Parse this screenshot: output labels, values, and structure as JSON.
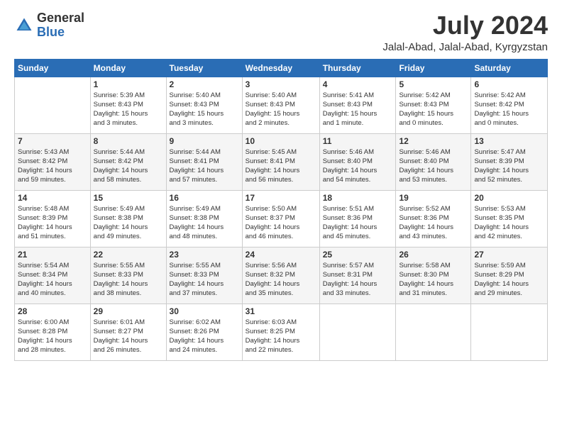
{
  "header": {
    "logo_general": "General",
    "logo_blue": "Blue",
    "month_title": "July 2024",
    "location": "Jalal-Abad, Jalal-Abad, Kyrgyzstan"
  },
  "weekdays": [
    "Sunday",
    "Monday",
    "Tuesday",
    "Wednesday",
    "Thursday",
    "Friday",
    "Saturday"
  ],
  "weeks": [
    [
      {
        "day": "",
        "info": ""
      },
      {
        "day": "1",
        "info": "Sunrise: 5:39 AM\nSunset: 8:43 PM\nDaylight: 15 hours\nand 3 minutes."
      },
      {
        "day": "2",
        "info": "Sunrise: 5:40 AM\nSunset: 8:43 PM\nDaylight: 15 hours\nand 3 minutes."
      },
      {
        "day": "3",
        "info": "Sunrise: 5:40 AM\nSunset: 8:43 PM\nDaylight: 15 hours\nand 2 minutes."
      },
      {
        "day": "4",
        "info": "Sunrise: 5:41 AM\nSunset: 8:43 PM\nDaylight: 15 hours\nand 1 minute."
      },
      {
        "day": "5",
        "info": "Sunrise: 5:42 AM\nSunset: 8:43 PM\nDaylight: 15 hours\nand 0 minutes."
      },
      {
        "day": "6",
        "info": "Sunrise: 5:42 AM\nSunset: 8:42 PM\nDaylight: 15 hours\nand 0 minutes."
      }
    ],
    [
      {
        "day": "7",
        "info": "Sunrise: 5:43 AM\nSunset: 8:42 PM\nDaylight: 14 hours\nand 59 minutes."
      },
      {
        "day": "8",
        "info": "Sunrise: 5:44 AM\nSunset: 8:42 PM\nDaylight: 14 hours\nand 58 minutes."
      },
      {
        "day": "9",
        "info": "Sunrise: 5:44 AM\nSunset: 8:41 PM\nDaylight: 14 hours\nand 57 minutes."
      },
      {
        "day": "10",
        "info": "Sunrise: 5:45 AM\nSunset: 8:41 PM\nDaylight: 14 hours\nand 56 minutes."
      },
      {
        "day": "11",
        "info": "Sunrise: 5:46 AM\nSunset: 8:40 PM\nDaylight: 14 hours\nand 54 minutes."
      },
      {
        "day": "12",
        "info": "Sunrise: 5:46 AM\nSunset: 8:40 PM\nDaylight: 14 hours\nand 53 minutes."
      },
      {
        "day": "13",
        "info": "Sunrise: 5:47 AM\nSunset: 8:39 PM\nDaylight: 14 hours\nand 52 minutes."
      }
    ],
    [
      {
        "day": "14",
        "info": "Sunrise: 5:48 AM\nSunset: 8:39 PM\nDaylight: 14 hours\nand 51 minutes."
      },
      {
        "day": "15",
        "info": "Sunrise: 5:49 AM\nSunset: 8:38 PM\nDaylight: 14 hours\nand 49 minutes."
      },
      {
        "day": "16",
        "info": "Sunrise: 5:49 AM\nSunset: 8:38 PM\nDaylight: 14 hours\nand 48 minutes."
      },
      {
        "day": "17",
        "info": "Sunrise: 5:50 AM\nSunset: 8:37 PM\nDaylight: 14 hours\nand 46 minutes."
      },
      {
        "day": "18",
        "info": "Sunrise: 5:51 AM\nSunset: 8:36 PM\nDaylight: 14 hours\nand 45 minutes."
      },
      {
        "day": "19",
        "info": "Sunrise: 5:52 AM\nSunset: 8:36 PM\nDaylight: 14 hours\nand 43 minutes."
      },
      {
        "day": "20",
        "info": "Sunrise: 5:53 AM\nSunset: 8:35 PM\nDaylight: 14 hours\nand 42 minutes."
      }
    ],
    [
      {
        "day": "21",
        "info": "Sunrise: 5:54 AM\nSunset: 8:34 PM\nDaylight: 14 hours\nand 40 minutes."
      },
      {
        "day": "22",
        "info": "Sunrise: 5:55 AM\nSunset: 8:33 PM\nDaylight: 14 hours\nand 38 minutes."
      },
      {
        "day": "23",
        "info": "Sunrise: 5:55 AM\nSunset: 8:33 PM\nDaylight: 14 hours\nand 37 minutes."
      },
      {
        "day": "24",
        "info": "Sunrise: 5:56 AM\nSunset: 8:32 PM\nDaylight: 14 hours\nand 35 minutes."
      },
      {
        "day": "25",
        "info": "Sunrise: 5:57 AM\nSunset: 8:31 PM\nDaylight: 14 hours\nand 33 minutes."
      },
      {
        "day": "26",
        "info": "Sunrise: 5:58 AM\nSunset: 8:30 PM\nDaylight: 14 hours\nand 31 minutes."
      },
      {
        "day": "27",
        "info": "Sunrise: 5:59 AM\nSunset: 8:29 PM\nDaylight: 14 hours\nand 29 minutes."
      }
    ],
    [
      {
        "day": "28",
        "info": "Sunrise: 6:00 AM\nSunset: 8:28 PM\nDaylight: 14 hours\nand 28 minutes."
      },
      {
        "day": "29",
        "info": "Sunrise: 6:01 AM\nSunset: 8:27 PM\nDaylight: 14 hours\nand 26 minutes."
      },
      {
        "day": "30",
        "info": "Sunrise: 6:02 AM\nSunset: 8:26 PM\nDaylight: 14 hours\nand 24 minutes."
      },
      {
        "day": "31",
        "info": "Sunrise: 6:03 AM\nSunset: 8:25 PM\nDaylight: 14 hours\nand 22 minutes."
      },
      {
        "day": "",
        "info": ""
      },
      {
        "day": "",
        "info": ""
      },
      {
        "day": "",
        "info": ""
      }
    ]
  ]
}
